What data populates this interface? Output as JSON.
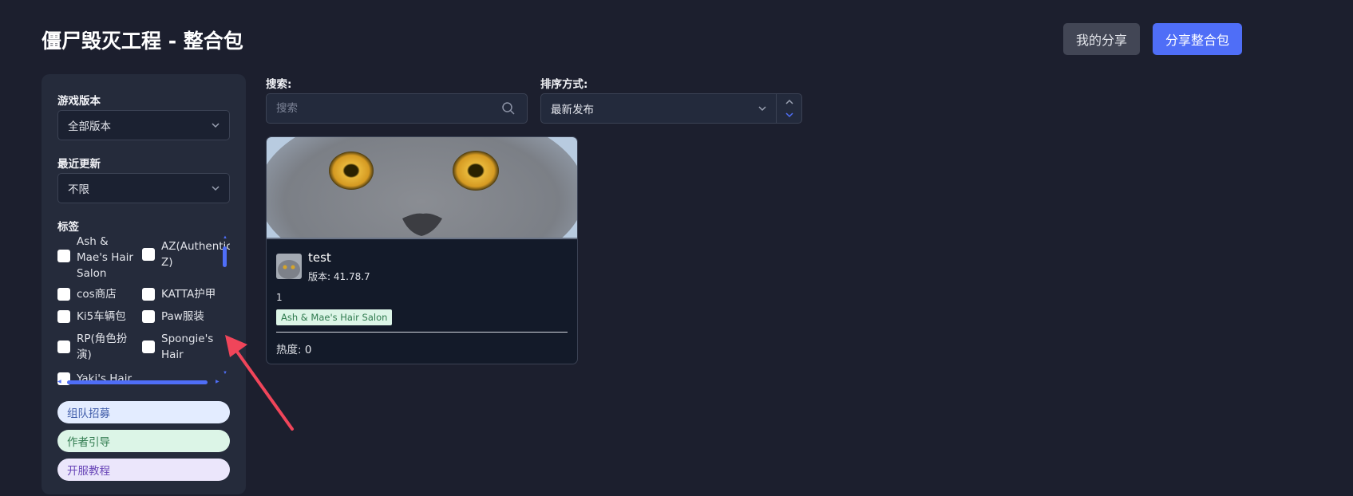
{
  "header": {
    "title": "僵尸毁灭工程 - 整合包",
    "my_share_label": "我的分享",
    "share_pack_label": "分享整合包"
  },
  "sidebar": {
    "game_version_label": "游戏版本",
    "game_version_value": "全部版本",
    "recent_update_label": "最近更新",
    "recent_update_value": "不限",
    "tags_label": "标签",
    "tags": [
      "Ash & Mae's Hair Salon",
      "AZ(Authentic Z)",
      "cos商店",
      "KATTA护甲",
      "Ki5车辆包",
      "Paw服装",
      "RP(角色扮演)",
      "Spongie's Hair",
      "Yaki's Hair"
    ],
    "pills": {
      "team": "组队招募",
      "author": "作者引导",
      "server": "开服教程"
    }
  },
  "filters": {
    "search_label": "搜索:",
    "search_placeholder": "搜索",
    "sort_label": "排序方式:",
    "sort_value": "最新发布"
  },
  "cards": [
    {
      "title": "test",
      "version": "版本: 41.78.7",
      "description": "1",
      "tag": "Ash & Mae's Hair Salon",
      "hotness": "热度: 0"
    }
  ],
  "colors": {
    "background": "#1c1f2e",
    "panel": "#252b3b",
    "accent": "#4f6ef7",
    "annotation_arrow": "#f0455a"
  }
}
